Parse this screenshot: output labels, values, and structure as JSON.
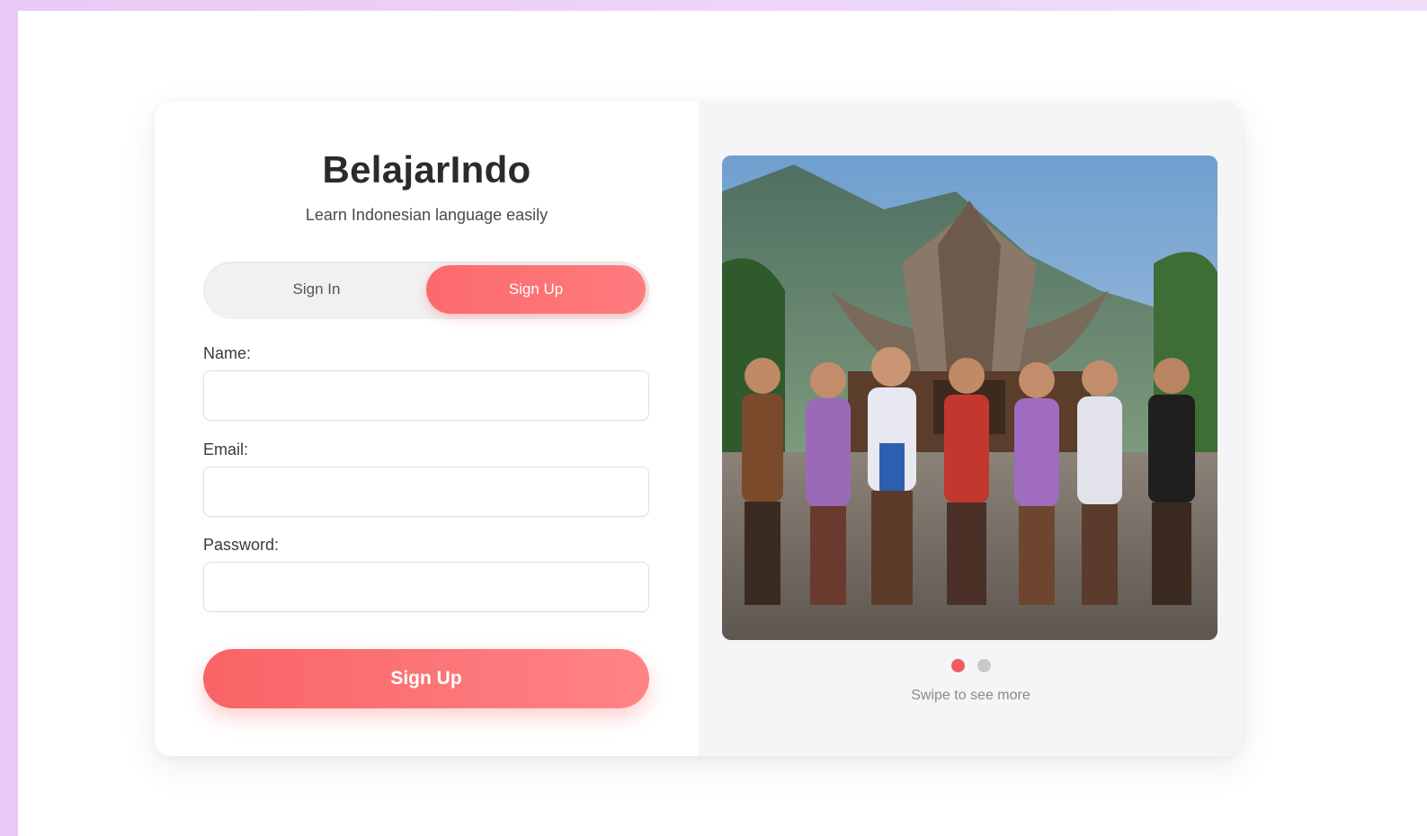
{
  "app": {
    "brand": "BelajarIndo",
    "tagline": "Learn Indonesian language easily"
  },
  "auth_toggle": {
    "sign_in_label": "Sign In",
    "sign_up_label": "Sign Up",
    "active": "Sign Up"
  },
  "form": {
    "name_label": "Name:",
    "name_value": "",
    "email_label": "Email:",
    "email_value": "",
    "password_label": "Password:",
    "password_value": "",
    "submit_label": "Sign Up"
  },
  "carousel": {
    "slide_count": 2,
    "active_index": 0,
    "hint": "Swipe to see more",
    "image_subject": "children-in-traditional-indonesian-dress"
  },
  "colors": {
    "accent": "#fb6a6c",
    "accent_light": "#ff8487",
    "background_gradient_start": "#e9c9f6",
    "background_gradient_end": "#f1def9",
    "text_dark": "#2b2b2b",
    "dot_inactive": "#c9c9cc"
  }
}
